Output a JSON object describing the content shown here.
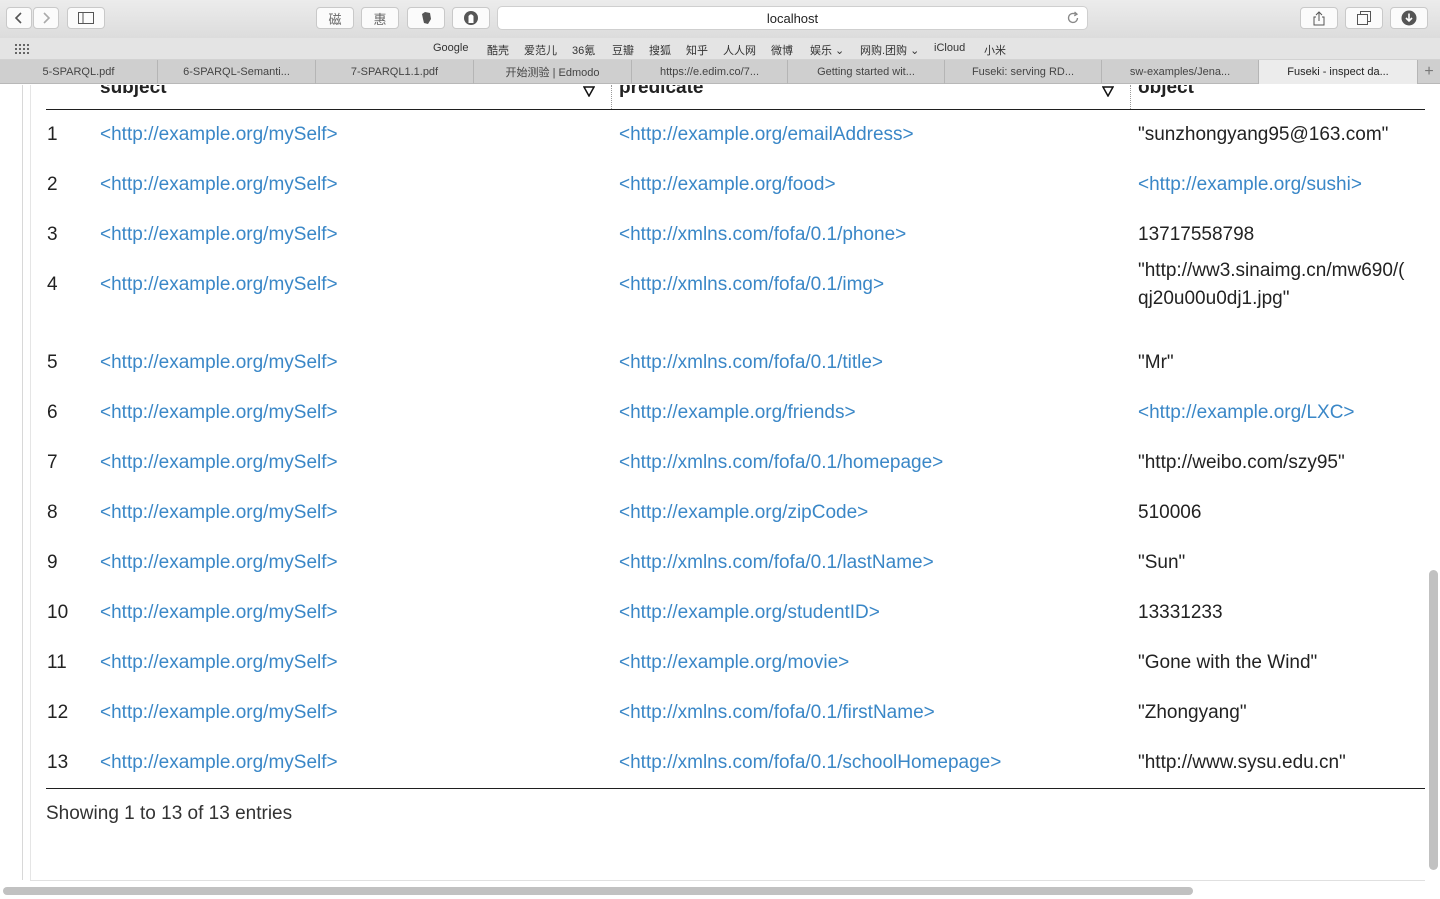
{
  "browser": {
    "url": "localhost",
    "ext_buttons": [
      "磁",
      "惠"
    ],
    "favorites": [
      "Google",
      "酷壳",
      "爱范儿",
      "36氪",
      "豆瓣",
      "搜狐",
      "知乎",
      "人人网",
      "微博",
      "娱乐 ⌄",
      "网购.团购 ⌄",
      "iCloud",
      "小米"
    ],
    "tabs": [
      "5-SPARQL.pdf",
      "6-SPARQL-Semanti...",
      "7-SPARQL1.1.pdf",
      "开始测验 | Edmodo",
      "https://e.edim.co/7...",
      "Getting started wit...",
      "Fuseki: serving RD...",
      "sw-examples/Jena...",
      "Fuseki - inspect da..."
    ],
    "active_tab_index": 8,
    "new_tab_label": "+"
  },
  "table": {
    "headers": {
      "subject": "subject",
      "predicate": "predicate",
      "object": "object"
    },
    "rows": [
      {
        "n": "1",
        "subject": "<http://example.org/mySelf>",
        "predicate": "<http://example.org/emailAddress>",
        "object": "\"sunzhongyang95@163.com\"",
        "object_link": false
      },
      {
        "n": "2",
        "subject": "<http://example.org/mySelf>",
        "predicate": "<http://example.org/food>",
        "object": "<http://example.org/sushi>",
        "object_link": true
      },
      {
        "n": "3",
        "subject": "<http://example.org/mySelf>",
        "predicate": "<http://xmlns.com/fofa/0.1/phone>",
        "object": "13717558798",
        "object_link": false
      },
      {
        "n": "4",
        "subject": "<http://example.org/mySelf>",
        "predicate": "<http://xmlns.com/fofa/0.1/img>",
        "object": "\"http://ww3.sinaimg.cn/mw690/(",
        "object_line2": "qj20u00u0dj1.jpg\"",
        "object_link": false
      },
      {
        "n": "5",
        "subject": "<http://example.org/mySelf>",
        "predicate": "<http://xmlns.com/fofa/0.1/title>",
        "object": "\"Mr\"",
        "object_link": false
      },
      {
        "n": "6",
        "subject": "<http://example.org/mySelf>",
        "predicate": "<http://example.org/friends>",
        "object": "<http://example.org/LXC>",
        "object_link": true
      },
      {
        "n": "7",
        "subject": "<http://example.org/mySelf>",
        "predicate": "<http://xmlns.com/fofa/0.1/homepage>",
        "object": "\"http://weibo.com/szy95\"",
        "object_link": false
      },
      {
        "n": "8",
        "subject": "<http://example.org/mySelf>",
        "predicate": "<http://example.org/zipCode>",
        "object": "510006",
        "object_link": false
      },
      {
        "n": "9",
        "subject": "<http://example.org/mySelf>",
        "predicate": "<http://xmlns.com/fofa/0.1/lastName>",
        "object": "\"Sun\"",
        "object_link": false
      },
      {
        "n": "10",
        "subject": "<http://example.org/mySelf>",
        "predicate": "<http://example.org/studentID>",
        "object": "13331233",
        "object_link": false
      },
      {
        "n": "11",
        "subject": "<http://example.org/mySelf>",
        "predicate": "<http://example.org/movie>",
        "object": "\"Gone with the Wind\"",
        "object_link": false
      },
      {
        "n": "12",
        "subject": "<http://example.org/mySelf>",
        "predicate": "<http://xmlns.com/fofa/0.1/firstName>",
        "object": "\"Zhongyang\"",
        "object_link": false
      },
      {
        "n": "13",
        "subject": "<http://example.org/mySelf>",
        "predicate": "<http://xmlns.com/fofa/0.1/schoolHomepage>",
        "object": "\"http://www.sysu.edu.cn\"",
        "object_link": false
      }
    ],
    "info": "Showing 1 to 13 of 13 entries"
  },
  "colors": {
    "link": "#3a87c7",
    "text": "#222222"
  }
}
